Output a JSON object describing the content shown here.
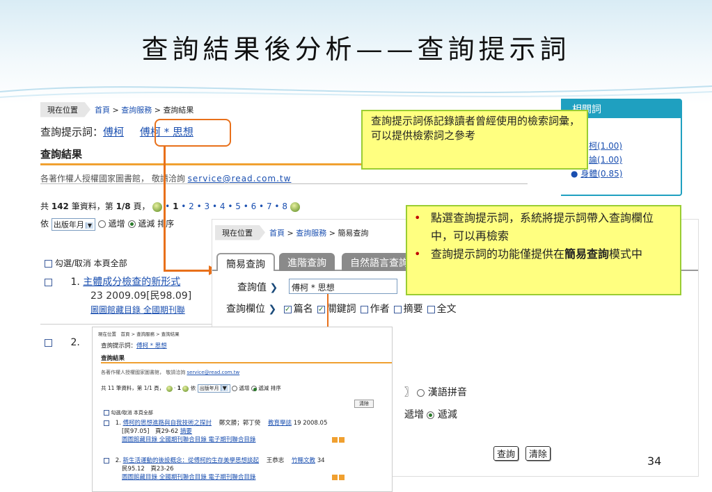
{
  "slide": {
    "title": "查詢結果後分析——查詢提示詞",
    "page_number": "34"
  },
  "main_shot": {
    "crumb_here": "現在位置",
    "crumb_home": "首頁",
    "crumb_service": "查詢服務",
    "crumb_current": "查詢結果",
    "hint_label": "查詢提示詞：",
    "hint_term1": "傅柯",
    "hint_term2": "傅柯 * 思想",
    "result_heading": "查詢結果",
    "copyright_text": "各著作權人授權國家圖書館， 敬請洽詢",
    "email": "service@read.com.tw",
    "total_prefix": "共",
    "total_count": "142",
    "total_mid": "筆資料，第",
    "page_cur": "1/8",
    "total_suffix": "頁，",
    "pages": [
      "1",
      "2",
      "3",
      "4",
      "5",
      "6",
      "7",
      "8"
    ],
    "sort_prefix": "依",
    "sort_value": "出版年月",
    "sort_inc": "遞增",
    "sort_dec": "遞減 排序",
    "select_all": "勾選/取消 本頁全部",
    "item1_num": "1.",
    "item1_title": "主體成分檢查的新形式",
    "item1_meta": "23 2009.09[民98.09]",
    "item1_links": "圖圖館藏目錄 全國期刊聯",
    "item2_num": "2."
  },
  "related": {
    "header": "相關詞",
    "items": [
      {
        "label": "柯(1.00)"
      },
      {
        "label": "論(1.00)"
      },
      {
        "label": "身體(0.85)"
      }
    ]
  },
  "note_top": {
    "text": "查詢提示詞係記錄讀者曾經使用的檢索詞彙，可以提供檢索詞之參考"
  },
  "note_right": {
    "bullet1": "點選查詢提示詞，系統將提示詞帶入查詢欄位中，可以再檢索",
    "bullet2_pre": "查詢提示詞的功能僅提供在",
    "bullet2_bold": "簡易查詢",
    "bullet2_post": "模式中"
  },
  "search_shot": {
    "crumb_here": "現在位置",
    "crumb_home": "首頁",
    "crumb_service": "查詢服務",
    "crumb_current": "簡易查詢",
    "tabs": [
      "簡易查詢",
      "進階查詢",
      "自然語言查詢"
    ],
    "query_label": "查詢值",
    "query_value": "傅柯 * 思想",
    "field_label": "查詢欄位",
    "fields": [
      "篇名",
      "關鍵詞",
      "作者",
      "摘要",
      "全文"
    ],
    "pinyin_label": "漢語拼音",
    "sort_inc": "遞增",
    "sort_dec": "遞減",
    "btn_search": "查詢",
    "btn_clear": "清除"
  },
  "small_shot": {
    "crumb": "現在位置　首頁 > 查詢服務 > 查詢結果",
    "hint_label": "查詢提示詞：",
    "hint_term": "傅柯 * 思想",
    "result_heading": "查詢結果",
    "copyright_text": "各著作權人授權國家圖書館， 敬請洽詢",
    "email": "service@read.com.tw",
    "total": "共 11 筆資料，第 1/1 頁，",
    "page": "1",
    "sort_prefix": "依",
    "sort_value": "出版年月",
    "sort_inc": "遞增",
    "sort_dec": "遞減 排序",
    "clear_btn": "清除",
    "select_all": "勾選/取消 本頁全部",
    "r1_num": "1.",
    "r1_title": "傅柯的思想進路與自我技術之探討",
    "r1_author": "鄭文勝；郭丁熒",
    "r1_journal": "教育學誌",
    "r1_vol": "19 2008.05",
    "r1_meta": "[民97.05]　頁29-62",
    "r1_abstract": "摘要",
    "r1_links": "圖圖館藏目錄 全國期刊聯合目錄 電子期刊聯合目錄",
    "r2_num": "2.",
    "r2_title": "新生活運動的後設概念：從傅柯的生存美學思想談起",
    "r2_author": "王恭志",
    "r2_journal": "竹縣文教",
    "r2_vol": "34",
    "r2_meta": "民95.12　頁23-26",
    "r2_links": "圖圖館藏目錄 全國期刊聯合目錄 電子期刊聯合目錄"
  }
}
